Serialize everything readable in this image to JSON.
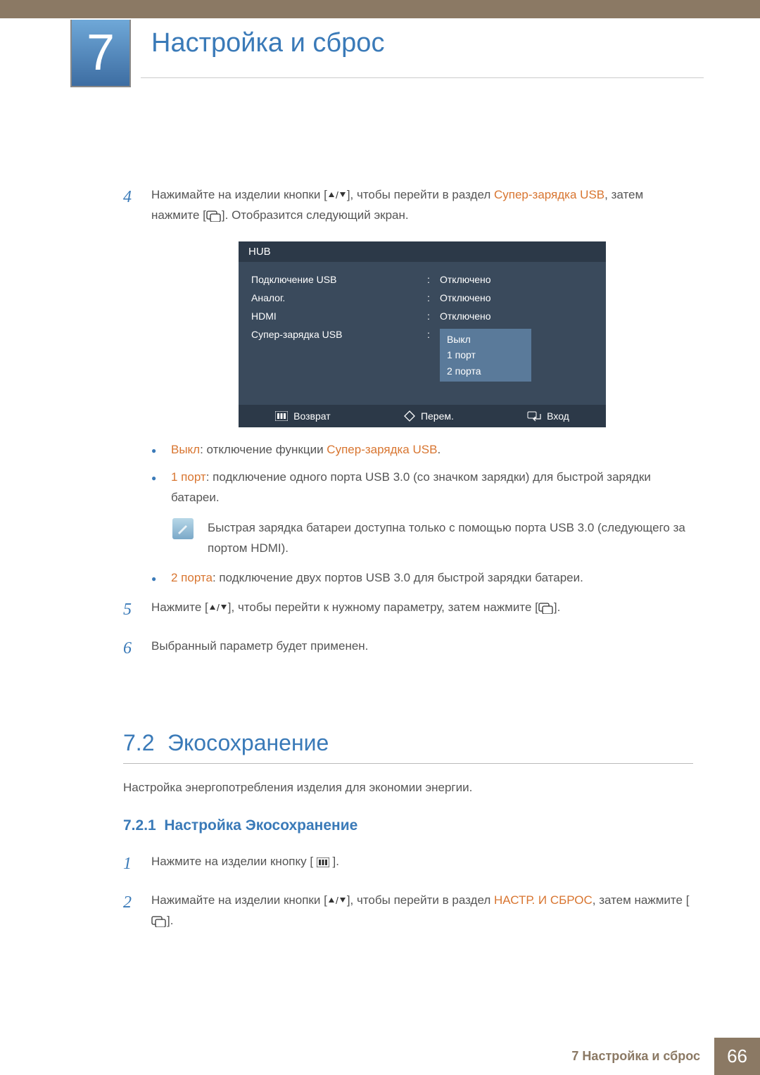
{
  "chapter": {
    "number": "7",
    "title": "Настройка и сброс"
  },
  "step4": {
    "number": "4",
    "text_before": "Нажимайте на изделии кнопки [",
    "text_mid1": "], чтобы перейти в раздел ",
    "highlight1": "Супер-зарядка USB",
    "text_mid2": ", затем нажмите [",
    "text_after": "]. Отобразится следующий экран."
  },
  "hub": {
    "title": "HUB",
    "rows": [
      {
        "label": "Подключение USB",
        "value": "Отключено"
      },
      {
        "label": "Аналог.",
        "value": "Отключено"
      },
      {
        "label": "HDMI",
        "value": "Отключено"
      }
    ],
    "active_row": {
      "label": "Супер-зарядка USB",
      "options": [
        "Выкл",
        "1 порт",
        "2 порта"
      ]
    },
    "footer": {
      "back": "Возврат",
      "move": "Перем.",
      "enter": "Вход"
    }
  },
  "bullets": [
    {
      "hl": "Выкл",
      "text": ": отключение функции ",
      "hl2": "Супер-зарядка USB",
      "after": "."
    },
    {
      "hl": "1 порт",
      "text": ": подключение одного порта USB 3.0 (со значком зарядки) для быстрой зарядки батареи."
    }
  ],
  "note": "Быстрая зарядка батареи доступна только с помощью порта USB 3.0 (следующего за портом HDMI).",
  "bullet3": {
    "hl": "2 порта",
    "text": ": подключение двух портов USB 3.0 для быстрой зарядки батареи."
  },
  "step5": {
    "number": "5",
    "before": "Нажмите [",
    "mid": "], чтобы перейти к нужному параметру, затем нажмите [",
    "after": "]."
  },
  "step6": {
    "number": "6",
    "text": "Выбранный параметр будет применен."
  },
  "section72": {
    "number": "7.2",
    "title": "Экосохранение",
    "desc": "Настройка энергопотребления изделия для экономии энергии."
  },
  "section721": {
    "number": "7.2.1",
    "title": "Настройка Экосохранение"
  },
  "s721_step1": {
    "number": "1",
    "before": "Нажмите на изделии кнопку [ ",
    "after": " ]."
  },
  "s721_step2": {
    "number": "2",
    "before": "Нажимайте на изделии кнопки [",
    "mid": "], чтобы перейти в раздел ",
    "hl": "НАСТР. И СБРОС",
    "mid2": ", затем нажмите [",
    "after": "]."
  },
  "footer": {
    "text": "7 Настройка и сброс",
    "page": "66"
  }
}
